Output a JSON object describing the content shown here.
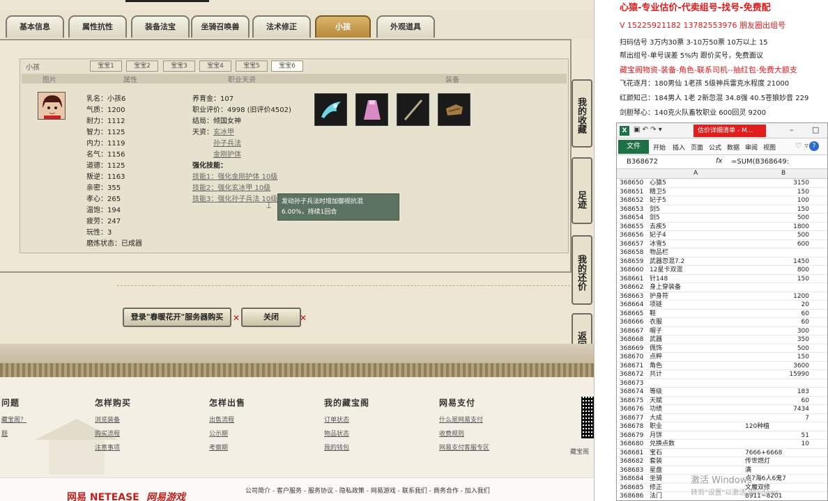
{
  "tabs": [
    "基本信息",
    "属性抗性",
    "装备法宝",
    "坐骑召唤兽",
    "法术修正",
    "小孩",
    "外观道具"
  ],
  "child": {
    "panel_title": "小孩",
    "baby_tabs": [
      "宝宝1",
      "宝宝2",
      "宝宝3",
      "宝宝4",
      "宝宝5",
      "宝宝6"
    ],
    "columns": [
      "图片",
      "属性",
      "职业天资",
      "装备"
    ],
    "stats": [
      "乳名：小孩6",
      "气质：1200",
      "耐力：1112",
      "智力：1125",
      "内力：1119",
      "名气：1156",
      "道德：1125",
      "叛逆：1163",
      "亲密：355",
      "孝心：265",
      "温饱：194",
      "疲劳：247",
      "玩性：3",
      "磨炼状态：已成器"
    ],
    "raise": "养育金：107",
    "eval": "职业评价：4998 (旧评价4502)",
    "ending": "结局：倾国女神",
    "talent_label": "天资：",
    "talents": [
      "玄冰甲",
      "孙子兵法",
      "金刚护体"
    ],
    "skill_label": "强化技能：",
    "skills": [
      "技能1：强化金刚护体 10级",
      "技能2：强化玄冰甲 10级",
      "技能3：强化孙子兵法 10级"
    ],
    "tooltip_line1": "发动孙子兵法时增加御视抗混",
    "tooltip_line2": "6.00%，持续1回合"
  },
  "buttons": {
    "buy": "登录\"春暖花开\"服务器购买",
    "close": "关闭"
  },
  "side_buttons": [
    "我的收藏",
    "足迹",
    "我的还价",
    "返回顶部"
  ],
  "footer": {
    "cols": [
      {
        "title": "问题",
        "links": [
          "藏宝阁？",
          "题"
        ]
      },
      {
        "title": "怎样购买",
        "links": [
          "浏览装备",
          "购买流程",
          "注意事项"
        ]
      },
      {
        "title": "怎样出售",
        "links": [
          "出售流程",
          "公示期",
          "考察期"
        ]
      },
      {
        "title": "我的藏宝阁",
        "links": [
          "订单状态",
          "物品状态",
          "我的钱包"
        ]
      },
      {
        "title": "网易支付",
        "links": [
          "什么是网易支付",
          "收费规则",
          "网易支付客服专区"
        ]
      }
    ],
    "qr_label": "藏宝阁",
    "bottom_links": "公司简介 - 客户服务 - 服务协议 - 隐私政策 - 网易游戏 - 联系我们 - 商务合作 - 加入我们",
    "logo1": "网易 NETEASE",
    "logo2": "网易游戏"
  },
  "ad": {
    "l1": "心猿-专业估价-代卖组号-找号-免费配",
    "l2": "V 15225921182   13782553976 朋友圈出组号",
    "l3": "扫码估号 3万内30票 3-10万50票  10万以上 15",
    "l4": "帮出组号-单号误差 5%内 跟价买号，免费面议",
    "l5": "藏宝阁物资-装备-角色-联系司机--抽红包-免费大额支",
    "l6": "飞花逐月：180男仙 1老孩 5级神兵雷克水程度 21000",
    "l7": "红颜知己：184男人 1老 2新忽混 34.8强 40.5苍狼妙音 229",
    "l8": "剑胆琴心：140克火队畜牧职业 600回灵 9200"
  },
  "excel": {
    "title": "估价详细清单 - M...",
    "menu": [
      "文件",
      "开始",
      "插入",
      "页面",
      "公式",
      "数据",
      "审阅",
      "视图"
    ],
    "cell": "B368672",
    "formula": "=SUM(B368649:",
    "cols": [
      "A",
      "B"
    ],
    "rows": [
      [
        "368650",
        "心猿5",
        "3150"
      ],
      [
        "368651",
        "精卫5",
        "150"
      ],
      [
        "368652",
        "妃子5",
        "100"
      ],
      [
        "368653",
        "剑5",
        "150"
      ],
      [
        "368654",
        "剑5",
        "500"
      ],
      [
        "368655",
        "去疾5",
        "1800"
      ],
      [
        "368656",
        "妃子4",
        "500"
      ],
      [
        "368657",
        "冰雪5",
        "600"
      ],
      [
        "368658",
        "物品栏",
        ""
      ],
      [
        "368659",
        "武器忽混7.2",
        "1450"
      ],
      [
        "368660",
        "12星卡双混",
        "800"
      ],
      [
        "368661",
        "针148",
        "150"
      ],
      [
        "368662",
        "身上穿装备",
        ""
      ],
      [
        "368663",
        "护身符",
        "1200"
      ],
      [
        "368664",
        "项链",
        "20"
      ],
      [
        "368665",
        "鞋",
        "60"
      ],
      [
        "368666",
        "衣服",
        "60"
      ],
      [
        "368667",
        "帽子",
        "300"
      ],
      [
        "368668",
        "武器",
        "350"
      ],
      [
        "368669",
        "佩饰",
        "500"
      ],
      [
        "368670",
        "点粹",
        "150"
      ],
      [
        "368671",
        "角色",
        "3600"
      ],
      [
        "368672",
        "共计",
        "15990"
      ],
      [
        "368673",
        "",
        ""
      ],
      [
        "368674",
        "等级",
        "183"
      ],
      [
        "368675",
        "天赋",
        "60"
      ],
      [
        "368676",
        "功绩",
        "7434"
      ],
      [
        "368677",
        "大成",
        "7"
      ],
      [
        "368678",
        "职业",
        "120种植"
      ],
      [
        "368679",
        "月饼",
        "51"
      ],
      [
        "368680",
        "兑换点数",
        "10"
      ],
      [
        "368681",
        "宝石",
        "7666+6668"
      ],
      [
        "368682",
        "套装",
        "传世燃灯"
      ],
      [
        "368683",
        "星盘",
        "满"
      ],
      [
        "368684",
        "坐骑",
        "点7海6人6鬼7"
      ],
      [
        "368685",
        "修正",
        "文魔双修"
      ],
      [
        "368686",
        "法门",
        "8911~8201"
      ]
    ],
    "watermark": "激活 Windows",
    "watermark2": "转到\"设置\"以激活 Windows。"
  }
}
